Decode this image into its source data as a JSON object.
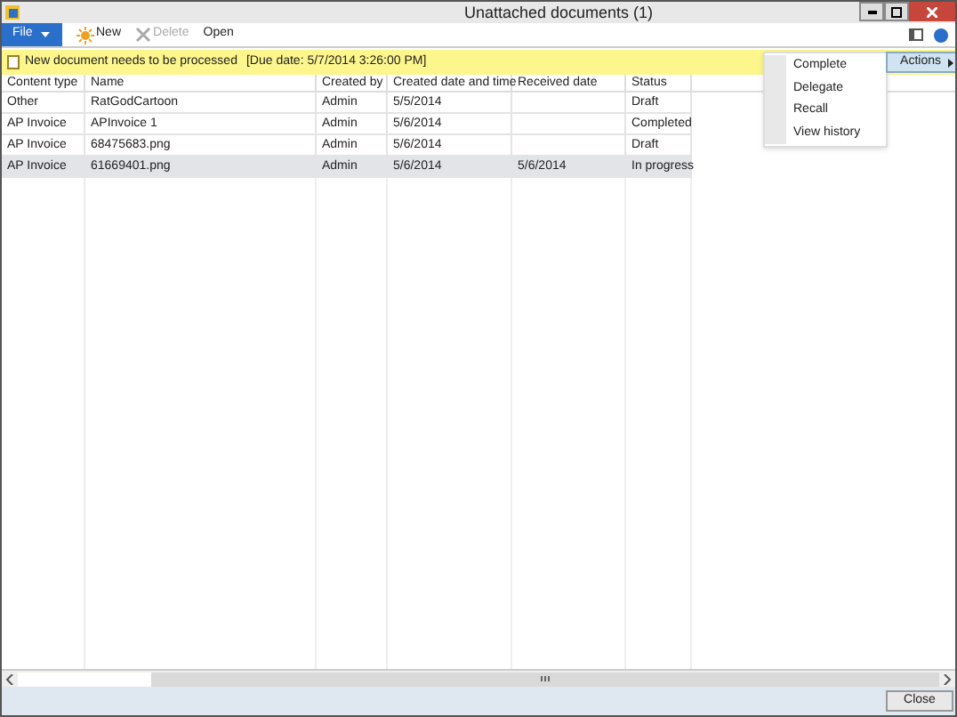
{
  "window": {
    "title": "Unattached documents (1)"
  },
  "toolbar": {
    "file_menu": "File",
    "buttons": [
      {
        "kind": "new",
        "label": "New",
        "disabled": false
      },
      {
        "kind": "delete",
        "label": "Delete",
        "disabled": true
      },
      {
        "kind": "open",
        "label": "Open",
        "disabled": false
      }
    ]
  },
  "info_bar": {
    "message": "New document needs to be processed",
    "due": "[Due date: 5/7/2014 3:26:00 PM]"
  },
  "actions": {
    "label": "Actions",
    "items": [
      "Complete",
      "Delegate",
      "Recall",
      "View history"
    ]
  },
  "table": {
    "columns": [
      "Content type",
      "Name",
      "Created by",
      "Created date and time",
      "Received date",
      "Status"
    ],
    "rows": [
      {
        "cells": [
          "Other",
          "RatGodCartoon",
          "Admin",
          "5/5/2014",
          "",
          "Draft"
        ],
        "selected": false
      },
      {
        "cells": [
          "AP Invoice",
          "APInvoice 1",
          "Admin",
          "5/6/2014",
          "",
          "Completed"
        ],
        "selected": false
      },
      {
        "cells": [
          "AP Invoice",
          "68475683.png",
          "Admin",
          "5/6/2014",
          "",
          "Draft"
        ],
        "selected": false
      },
      {
        "cells": [
          "AP Invoice",
          "61669401.png",
          "Admin",
          "5/6/2014",
          "5/6/2014",
          "In progress"
        ],
        "selected": true
      }
    ]
  },
  "footer": {
    "close": "Close"
  }
}
